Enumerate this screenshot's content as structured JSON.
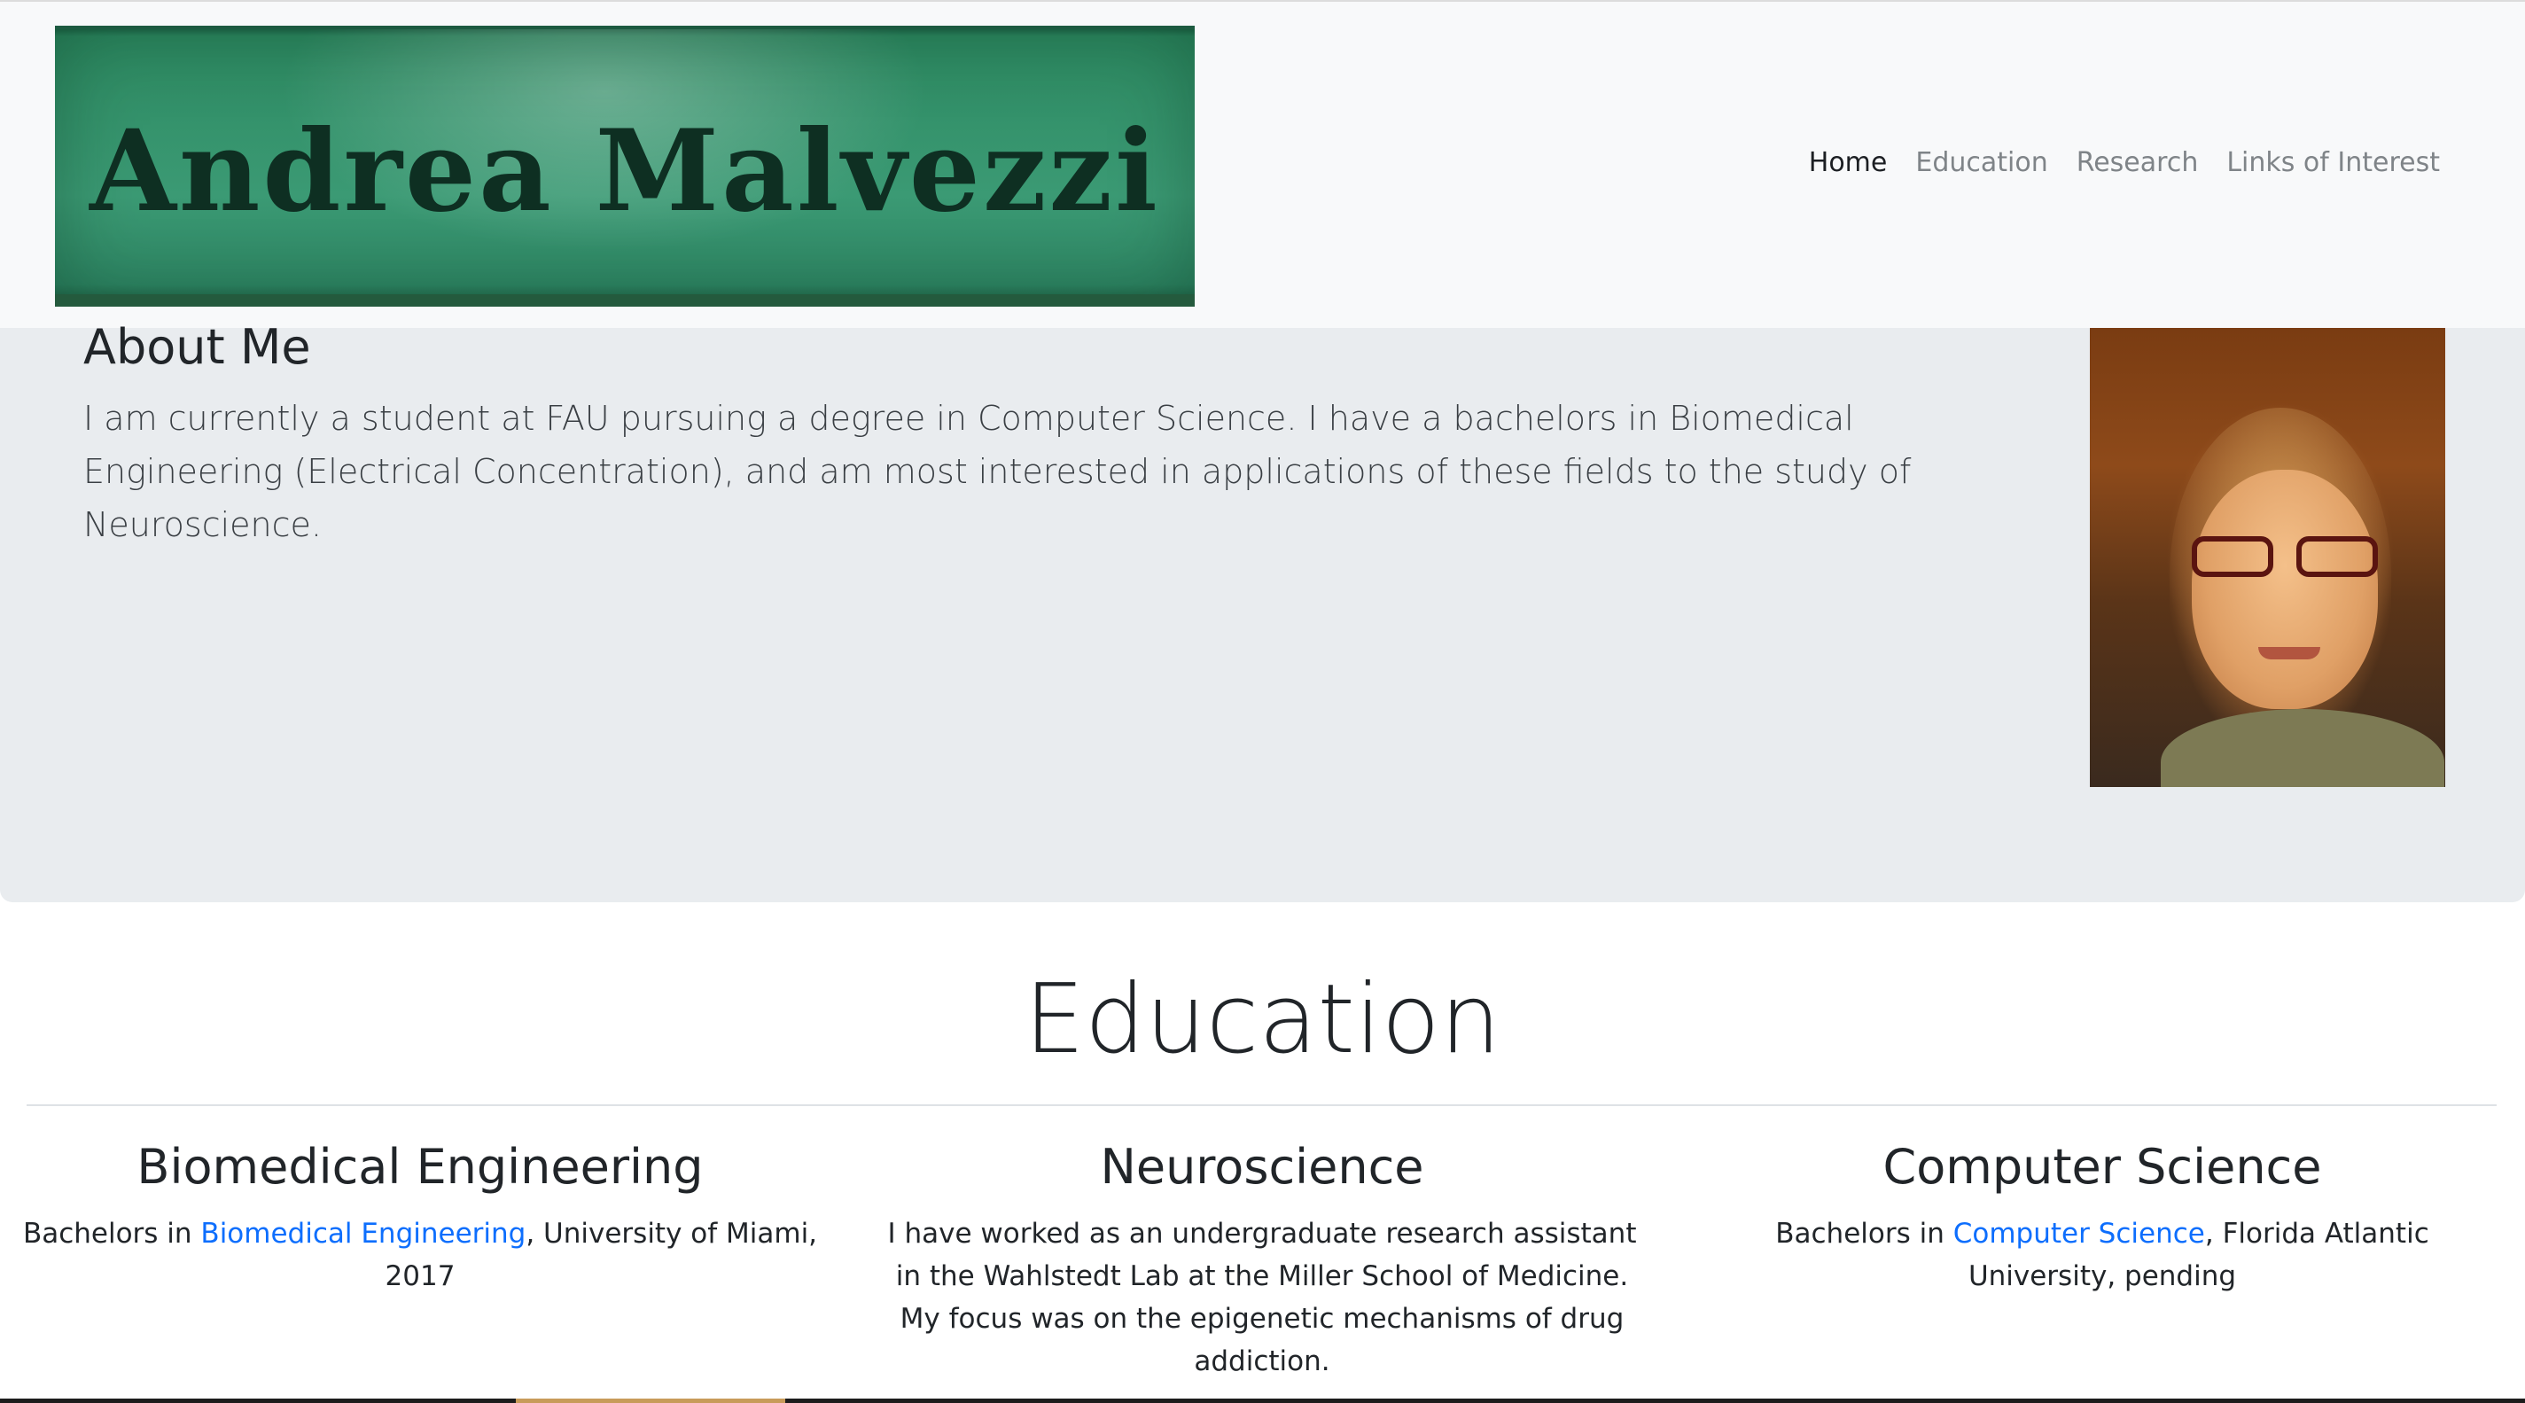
{
  "navbar": {
    "brand": "Andrea Malvezzi",
    "links": [
      {
        "label": "Home",
        "active": true
      },
      {
        "label": "Education",
        "active": false
      },
      {
        "label": "Research",
        "active": false
      },
      {
        "label": "Links of Interest",
        "active": false
      }
    ]
  },
  "about": {
    "title": "About Me",
    "text": "I am currently a student at FAU pursuing a degree in Computer Science. I have a bachelors in Biomedical Engineering (Electrical Concentration), and am most interested in applications of these fields to the study of Neuroscience."
  },
  "education": {
    "heading": "Education",
    "columns": [
      {
        "title": "Biomedical Engineering",
        "prefix": "Bachelors in ",
        "link": "Biomedical Engineering",
        "suffix": ", University of Miami, 2017"
      },
      {
        "title": "Neuroscience",
        "text": "I have worked as an undergraduate research assistant in the Wahlstedt Lab at the Miller School of Medicine. My focus was on the epigenetic mechanisms of drug addiction."
      },
      {
        "title": "Computer Science",
        "prefix": "Bachelors in ",
        "link": "Computer Science",
        "suffix": ", Florida Atlantic University, pending"
      }
    ]
  },
  "colors": {
    "navbar_bg": "#f8f9fa",
    "jumbotron_bg": "#e9ecef",
    "link": "#0d6efd",
    "banner_green": "#3b9a74"
  }
}
